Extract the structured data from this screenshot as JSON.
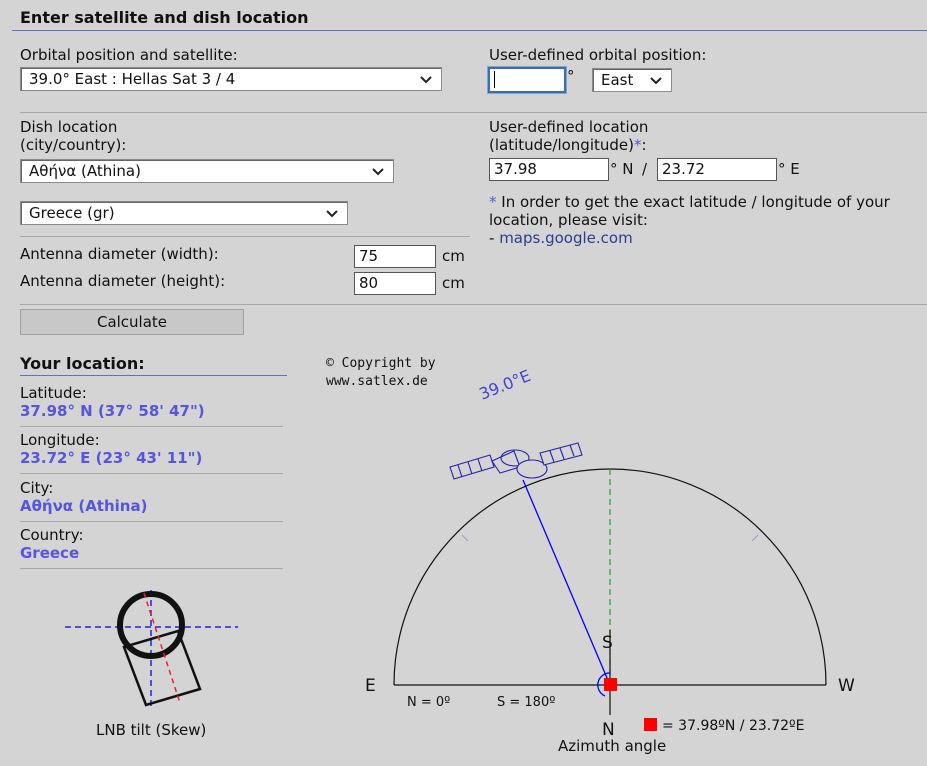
{
  "header": {
    "title": "Enter satellite and dish location"
  },
  "orbital": {
    "label": "Orbital position and satellite:",
    "selected": "39.0° East : Hellas Sat 3 / 4"
  },
  "user_orbital": {
    "label": "User-defined orbital position:",
    "value": "",
    "degree_symbol": "°",
    "direction": "East"
  },
  "dish": {
    "label_line1": "Dish location",
    "label_line2": "(city/country):",
    "city": "Αθήνα (Athina)",
    "country": "Greece (gr)"
  },
  "user_location": {
    "label_line1": "User-defined location",
    "label_line2_pre": "(latitude/longitude)",
    "star": "*",
    "colon": ":",
    "latitude": "37.98",
    "lat_unit": "° N",
    "separator": "/",
    "longitude": "23.72",
    "lon_unit": "° E",
    "note_star": "*",
    "note_text": " In order to get the exact latitude / longitude of your location, please visit:",
    "link_prefix": "- ",
    "link_text": "maps.google.com"
  },
  "antenna": {
    "width_label": "Antenna diameter (width):",
    "width_value": "75",
    "height_label": "Antenna diameter (height):",
    "height_value": "80",
    "unit": "cm"
  },
  "calculate": {
    "label": "Calculate"
  },
  "your_location": {
    "title": "Your location:",
    "latitude_label": "Latitude:",
    "latitude_value": "37.98° N (37° 58' 47\")",
    "longitude_label": "Longitude:",
    "longitude_value": "23.72° E (23° 43' 11\")",
    "city_label": "City:",
    "city_value": "Αθήνα (Athina)",
    "country_label": "Country:",
    "country_value": "Greece"
  },
  "skew": {
    "caption": "LNB tilt (Skew)"
  },
  "diagram": {
    "copyright_line1": "© Copyright by",
    "copyright_line2": "www.satlex.de",
    "satellite_label": "39.0°E",
    "label_s": "S",
    "label_n": "N",
    "label_e": "E",
    "label_w": "W",
    "n_label": "N = 0º",
    "s_label": "S = 180º",
    "location_legend": "= 37.98ºN / 23.72ºE",
    "caption": "Azimuth angle"
  },
  "colors": {
    "accent": "#5555dd",
    "marker": "#ff0000",
    "beam": "#0000ff",
    "meridian": "#22aa22"
  }
}
